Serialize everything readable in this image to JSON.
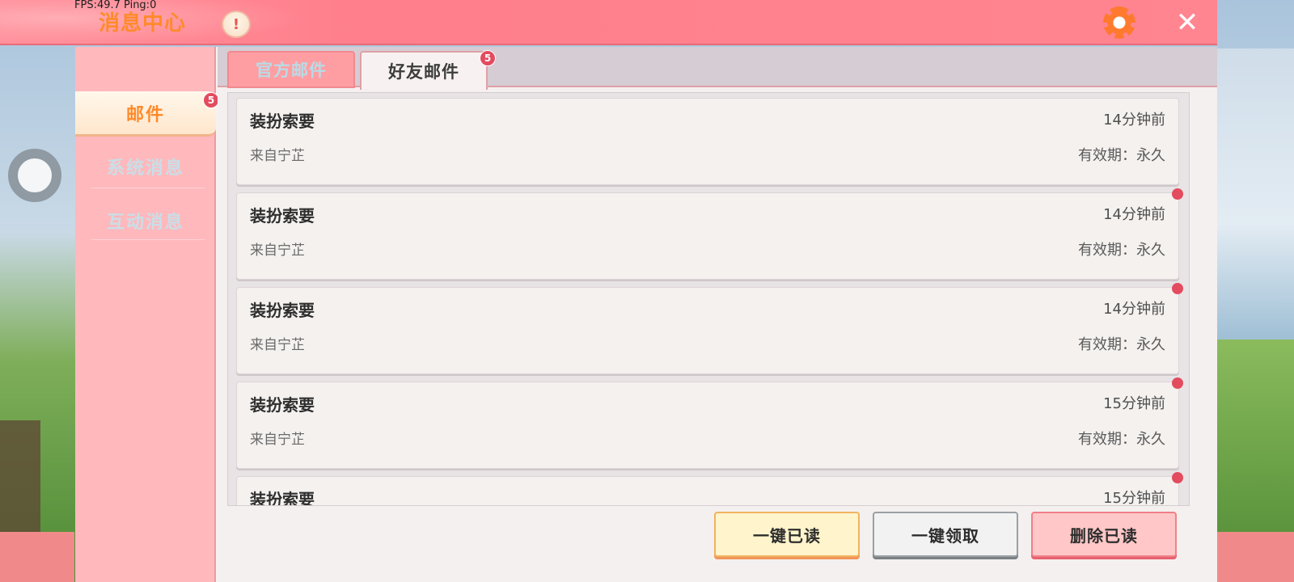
{
  "hud": {
    "text": "FPS:49.7  Ping:0"
  },
  "header": {
    "title": "消息中心",
    "notice_icon": "!",
    "close_icon": "✕"
  },
  "sidebar": {
    "items": [
      {
        "label": "邮件",
        "badge": "5",
        "active": true
      },
      {
        "label": "系统消息",
        "active": false
      },
      {
        "label": "互动消息",
        "active": false
      }
    ]
  },
  "tabs": [
    {
      "label": "官方邮件",
      "active": false
    },
    {
      "label": "好友邮件",
      "active": true,
      "badge": "5"
    }
  ],
  "mails": [
    {
      "title": "装扮索要",
      "time": "14分钟前",
      "from": "来自宁芷",
      "valid": "有效期：永久",
      "unread": false
    },
    {
      "title": "装扮索要",
      "time": "14分钟前",
      "from": "来自宁芷",
      "valid": "有效期：永久",
      "unread": true
    },
    {
      "title": "装扮索要",
      "time": "14分钟前",
      "from": "来自宁芷",
      "valid": "有效期：永久",
      "unread": true
    },
    {
      "title": "装扮索要",
      "time": "15分钟前",
      "from": "来自宁芷",
      "valid": "有效期：永久",
      "unread": true
    },
    {
      "title": "装扮索要",
      "time": "15分钟前",
      "from": "",
      "valid": "",
      "unread": true
    }
  ],
  "actions": {
    "read_all": "一键已读",
    "claim_all": "一键领取",
    "delete_read": "删除已读"
  },
  "colors": {
    "header": "#ff7f8c",
    "accent_orange": "#ff8a2a",
    "badge_red": "#e34b5f"
  }
}
